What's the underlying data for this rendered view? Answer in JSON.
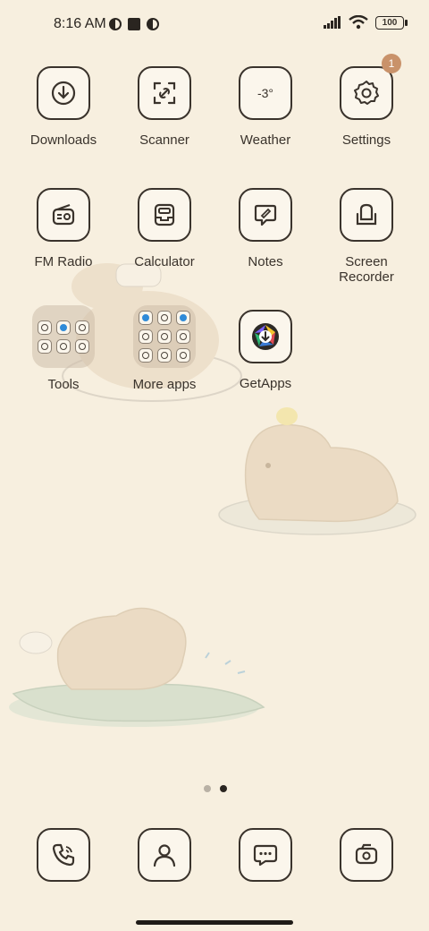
{
  "status_bar": {
    "time": "8:16 AM",
    "battery": "100"
  },
  "apps": {
    "downloads": "Downloads",
    "scanner": "Scanner",
    "weather": "Weather",
    "weather_temp": "-3°",
    "settings": "Settings",
    "settings_badge": "1",
    "fm_radio": "FM Radio",
    "calculator": "Calculator",
    "notes": "Notes",
    "screen_recorder_line1": "Screen",
    "screen_recorder_line2": "Recorder",
    "tools": "Tools",
    "more_apps": "More apps",
    "getapps": "GetApps"
  },
  "pager": {
    "total": 2,
    "active": 2
  },
  "dock": [
    "phone-icon",
    "contacts-icon",
    "messages-icon",
    "camera-icon"
  ]
}
